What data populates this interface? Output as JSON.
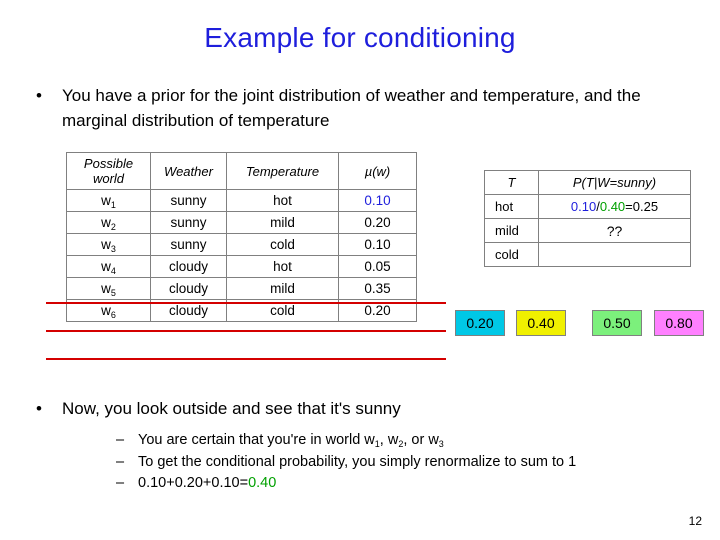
{
  "slide": {
    "title": "Example for conditioning",
    "page_number": "12"
  },
  "bullets": {
    "marker": "•",
    "prior": "You have a prior for the joint distribution of weather and temperature, and the marginal distribution of temperature",
    "now": "Now, you look outside and see that it's sunny"
  },
  "main_table": {
    "headers": {
      "possible_world_line1": "Possible",
      "possible_world_line2": "world",
      "weather": "Weather",
      "temperature": "Temperature",
      "mu": "µ(w)"
    },
    "rows": [
      {
        "w_letter": "w",
        "w_index": "1",
        "weather": "sunny",
        "temperature": "hot",
        "mu": "0.10",
        "mu_color": "blue",
        "struck": false
      },
      {
        "w_letter": "w",
        "w_index": "2",
        "weather": "sunny",
        "temperature": "mild",
        "mu": "0.20",
        "mu_color": "black",
        "struck": false
      },
      {
        "w_letter": "w",
        "w_index": "3",
        "weather": "sunny",
        "temperature": "cold",
        "mu": "0.10",
        "mu_color": "black",
        "struck": false
      },
      {
        "w_letter": "w",
        "w_index": "4",
        "weather": "cloudy",
        "temperature": "hot",
        "mu": "0.05",
        "mu_color": "black",
        "struck": true
      },
      {
        "w_letter": "w",
        "w_index": "5",
        "weather": "cloudy",
        "temperature": "mild",
        "mu": "0.35",
        "mu_color": "black",
        "struck": true
      },
      {
        "w_letter": "w",
        "w_index": "6",
        "weather": "cloudy",
        "temperature": "cold",
        "mu": "0.20",
        "mu_color": "black",
        "struck": true
      }
    ]
  },
  "cond_table": {
    "headers": {
      "t": "T",
      "p": "P(T|W=sunny)"
    },
    "rows": [
      {
        "t": "hot",
        "value_prefix": "0.10",
        "value_sep": "/",
        "value_mid": "0.40",
        "value_suffix": "=0.25",
        "is_question": false
      },
      {
        "t": "mild",
        "question": "??",
        "is_question": true
      },
      {
        "t": "cold",
        "question": "",
        "is_question": true
      }
    ]
  },
  "color_boxes": [
    {
      "label": "0.20",
      "color": "#00c8e6"
    },
    {
      "label": "0.40",
      "color": "#f0f000"
    },
    {
      "label": "0.50",
      "color": "#7cf07c"
    },
    {
      "label": "0.80",
      "color": "#ff80ff"
    }
  ],
  "sub_bullets": {
    "dash": "–",
    "items": [
      {
        "pre": "You are certain that you're in world w",
        "sub1": "1",
        "mid1": ", w",
        "sub2": "2",
        "mid2": ", or w",
        "sub3": "3",
        "post": ""
      },
      {
        "text": "To get the conditional probability, you simply renormalize to sum to 1"
      },
      {
        "pre": "0.10+0.20+0.10=",
        "highlight": "0.40"
      }
    ]
  }
}
